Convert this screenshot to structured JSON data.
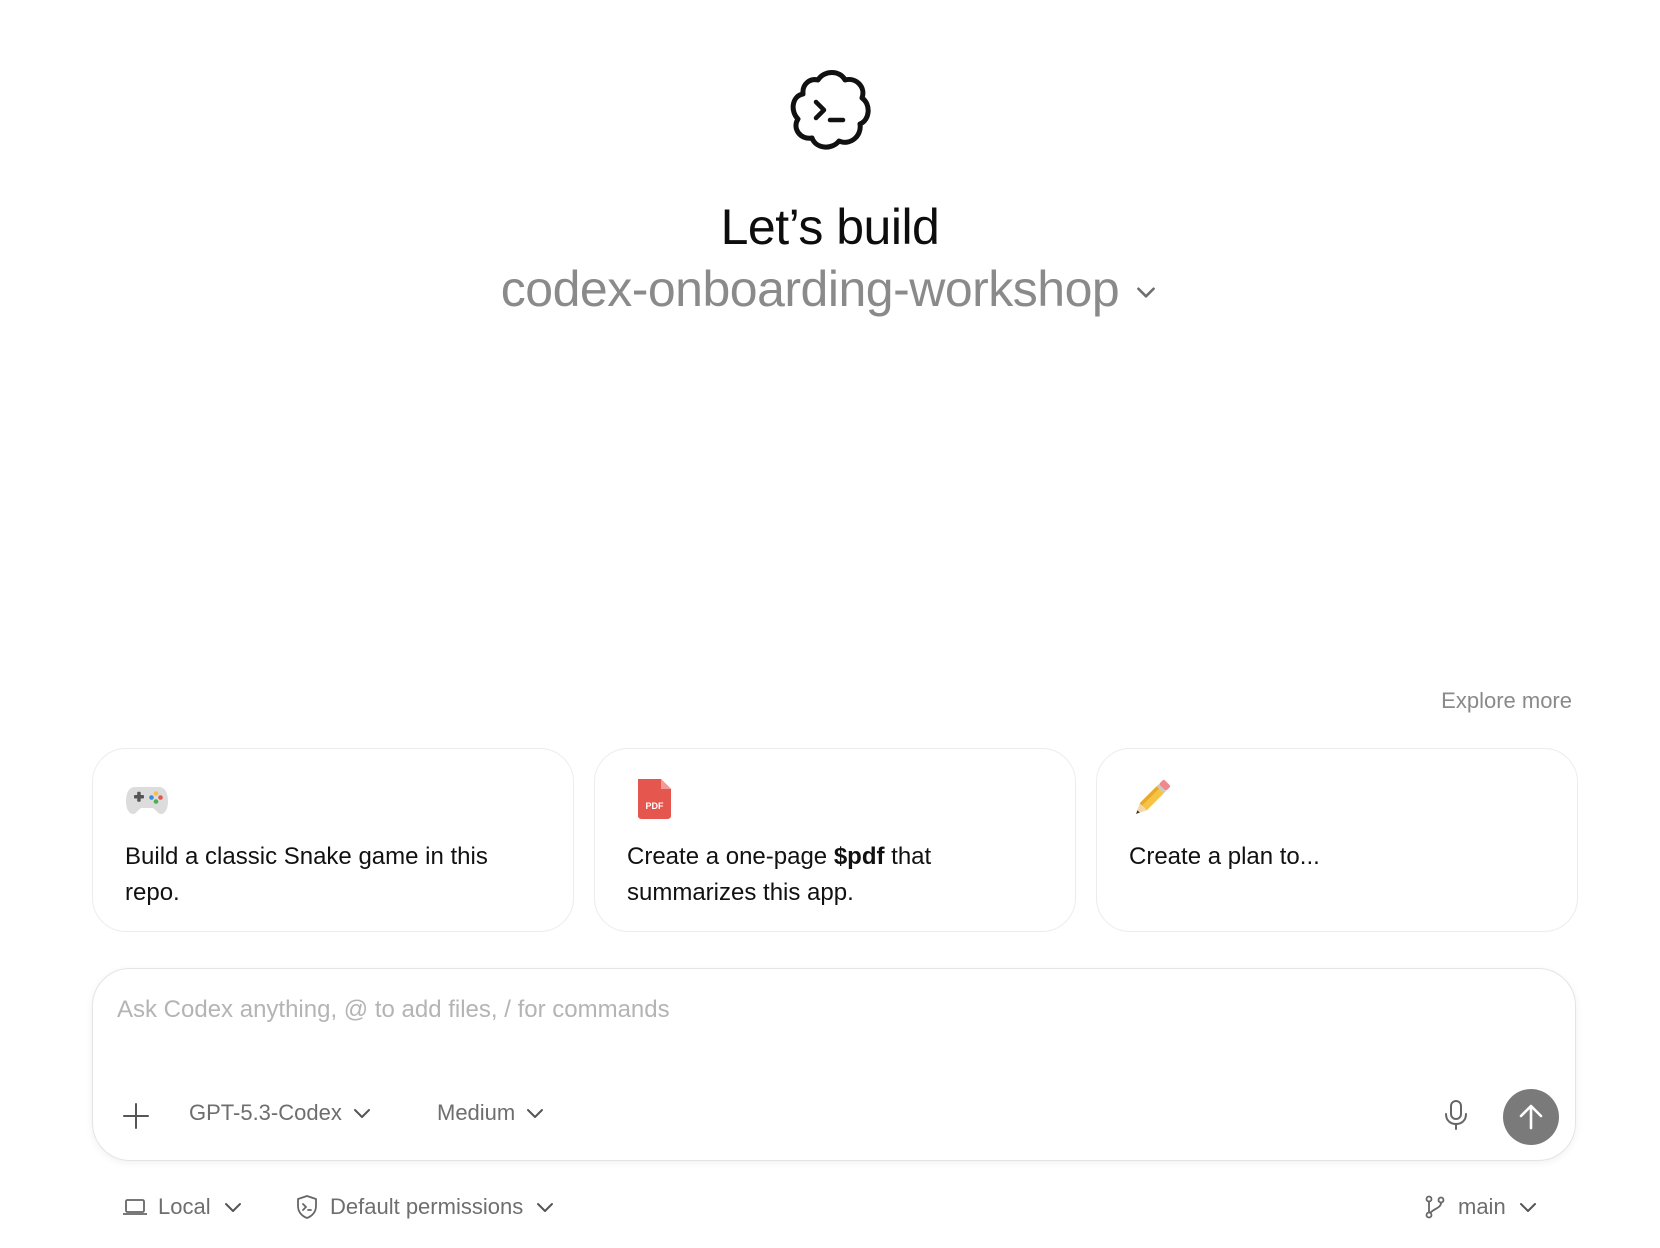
{
  "hero": {
    "title": "Let’s build",
    "project_name": "codex-onboarding-workshop"
  },
  "suggestions": {
    "explore_more": "Explore more",
    "cards": [
      {
        "icon": "game-controller-icon",
        "text": "Build a classic Snake game in this repo."
      },
      {
        "icon": "pdf-file-icon",
        "icon_text": "PDF",
        "text_before": "Create a one-page ",
        "text_bold": "$pdf",
        "text_after": " that summarizes this app."
      },
      {
        "icon": "pencil-icon",
        "text": "Create a plan to..."
      }
    ]
  },
  "composer": {
    "placeholder": "Ask Codex anything, @ to add files, / for commands",
    "model": "GPT-5.3-Codex",
    "reasoning": "Medium"
  },
  "footer": {
    "environment": "Local",
    "permissions": "Default permissions",
    "branch": "main"
  },
  "colors": {
    "accent_send": "#7a7a7a",
    "muted_text": "#8a8a8a",
    "pdf_red": "#e5564f"
  }
}
